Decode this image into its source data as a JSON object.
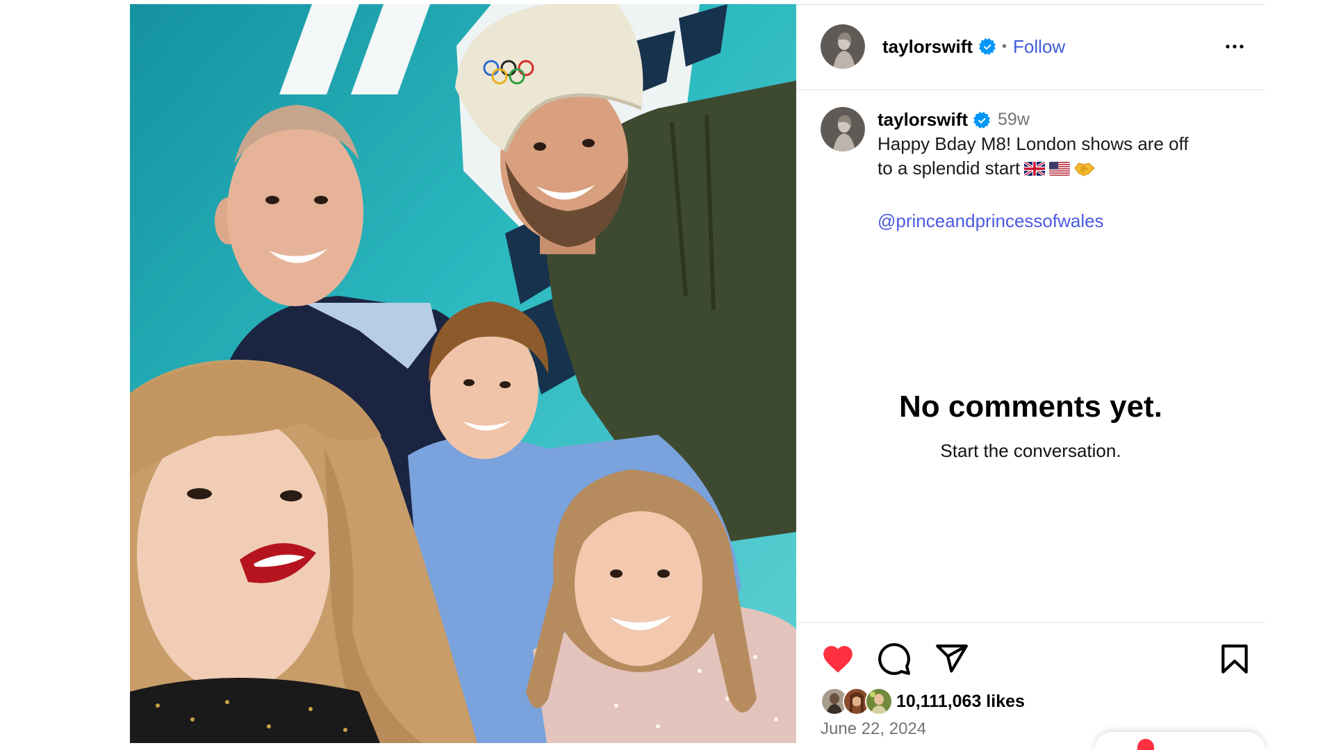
{
  "post": {
    "author": {
      "username": "taylorswift",
      "verified": true,
      "avatar_icon": "profile-avatar"
    },
    "header": {
      "separator": "•",
      "follow_label": "Follow",
      "more_icon": "more-horizontal-icon"
    },
    "caption": {
      "username": "taylorswift",
      "verified": true,
      "age": "59w",
      "line1": "Happy Bday M8! London shows are off",
      "line2": "to a splendid start",
      "line2_emojis": [
        "flag-united-kingdom",
        "flag-united-states",
        "handshake"
      ],
      "mention": "@princeandprincessofwales"
    },
    "comments": {
      "empty_title": "No comments yet.",
      "empty_subtitle": "Start the conversation."
    },
    "actions": {
      "liked": true,
      "like_icon": "heart-filled-icon",
      "comment_icon": "comment-icon",
      "share_icon": "paper-plane-icon",
      "save_icon": "bookmark-icon"
    },
    "likes": {
      "count_text": "10,111,063 likes",
      "liker_avatars": [
        "liker-avatar",
        "liker-avatar",
        "liker-avatar"
      ]
    },
    "date": "June 22, 2024"
  },
  "messages_popover": {
    "notification_dot": true
  },
  "colors": {
    "like_red": "#ff3040",
    "follow_blue": "#3f5bd6",
    "mention_blue": "#4a5be0",
    "verified_blue": "#0095f6",
    "muted_text": "#737373",
    "divider": "#dbdbdb"
  }
}
